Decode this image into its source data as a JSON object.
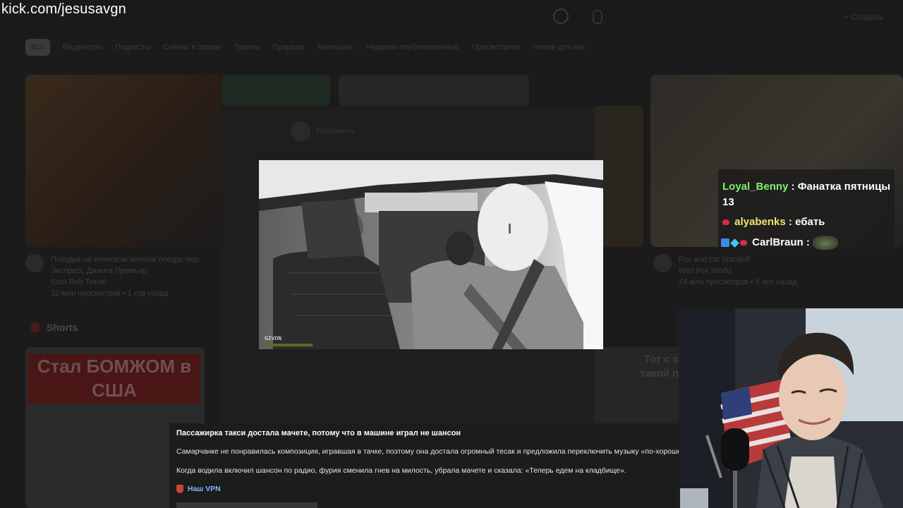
{
  "stream": {
    "url": "kick.com/jesusavgn"
  },
  "background": {
    "create_label": "Создать",
    "chips": [
      "Все",
      "Видеоигры",
      "Подкасты",
      "Сейчас в эфире",
      "Туризм",
      "Природа",
      "Анимация",
      "Недавно опубликованные",
      "Просмотрено",
      "Новое для вас"
    ],
    "video1": {
      "title": "Поездка на японском ночном поезде пер. Экспресс Джинга Премьер",
      "channel": "Sam Rob Travel",
      "stats": "32 млн просмотров • 1 год назад"
    },
    "video2": {
      "title": "Fox and cat Standoff.",
      "channel": "Wild Fox World",
      "stats": "24 млн просмотров • 5 лет назад"
    },
    "shorts_title": "Shorts",
    "short1_caption": "Стал БОМЖОМ в США",
    "short2_caption": "Тот с с такой п",
    "modal": {
      "header": "Избранное"
    }
  },
  "video": {
    "watermark": "GIVON"
  },
  "chat": [
    {
      "user": "Loyal_Benny",
      "sep": " : ",
      "message": "Фанатка пятницы 13",
      "color": "#7df26d"
    },
    {
      "user": "alyabenks",
      "sep": " : ",
      "message": "ебать",
      "color": "#f4e36a"
    },
    {
      "user": "CarlBraun",
      "sep": " : ",
      "message": "",
      "color": "#ffffff"
    }
  ],
  "description": {
    "title": "Пассажирка такси достала мачете, потому что в машине играл не шансон",
    "p1": "Самарчанке не понравилась композиция, игравшая в тачке, поэтому она достала огромный тесак и предложила переключить музыку «по-хорошему»",
    "p2": "Когда водила включил шансон по радио, фурия сменила гнев на милость, убрала мачете и сказала: «Теперь едем на кладбище».",
    "link": "Наш VPN"
  },
  "colors": {
    "chat_green": "#7df26d",
    "chat_yellow": "#f4e36a",
    "link": "#7fb6ff"
  }
}
